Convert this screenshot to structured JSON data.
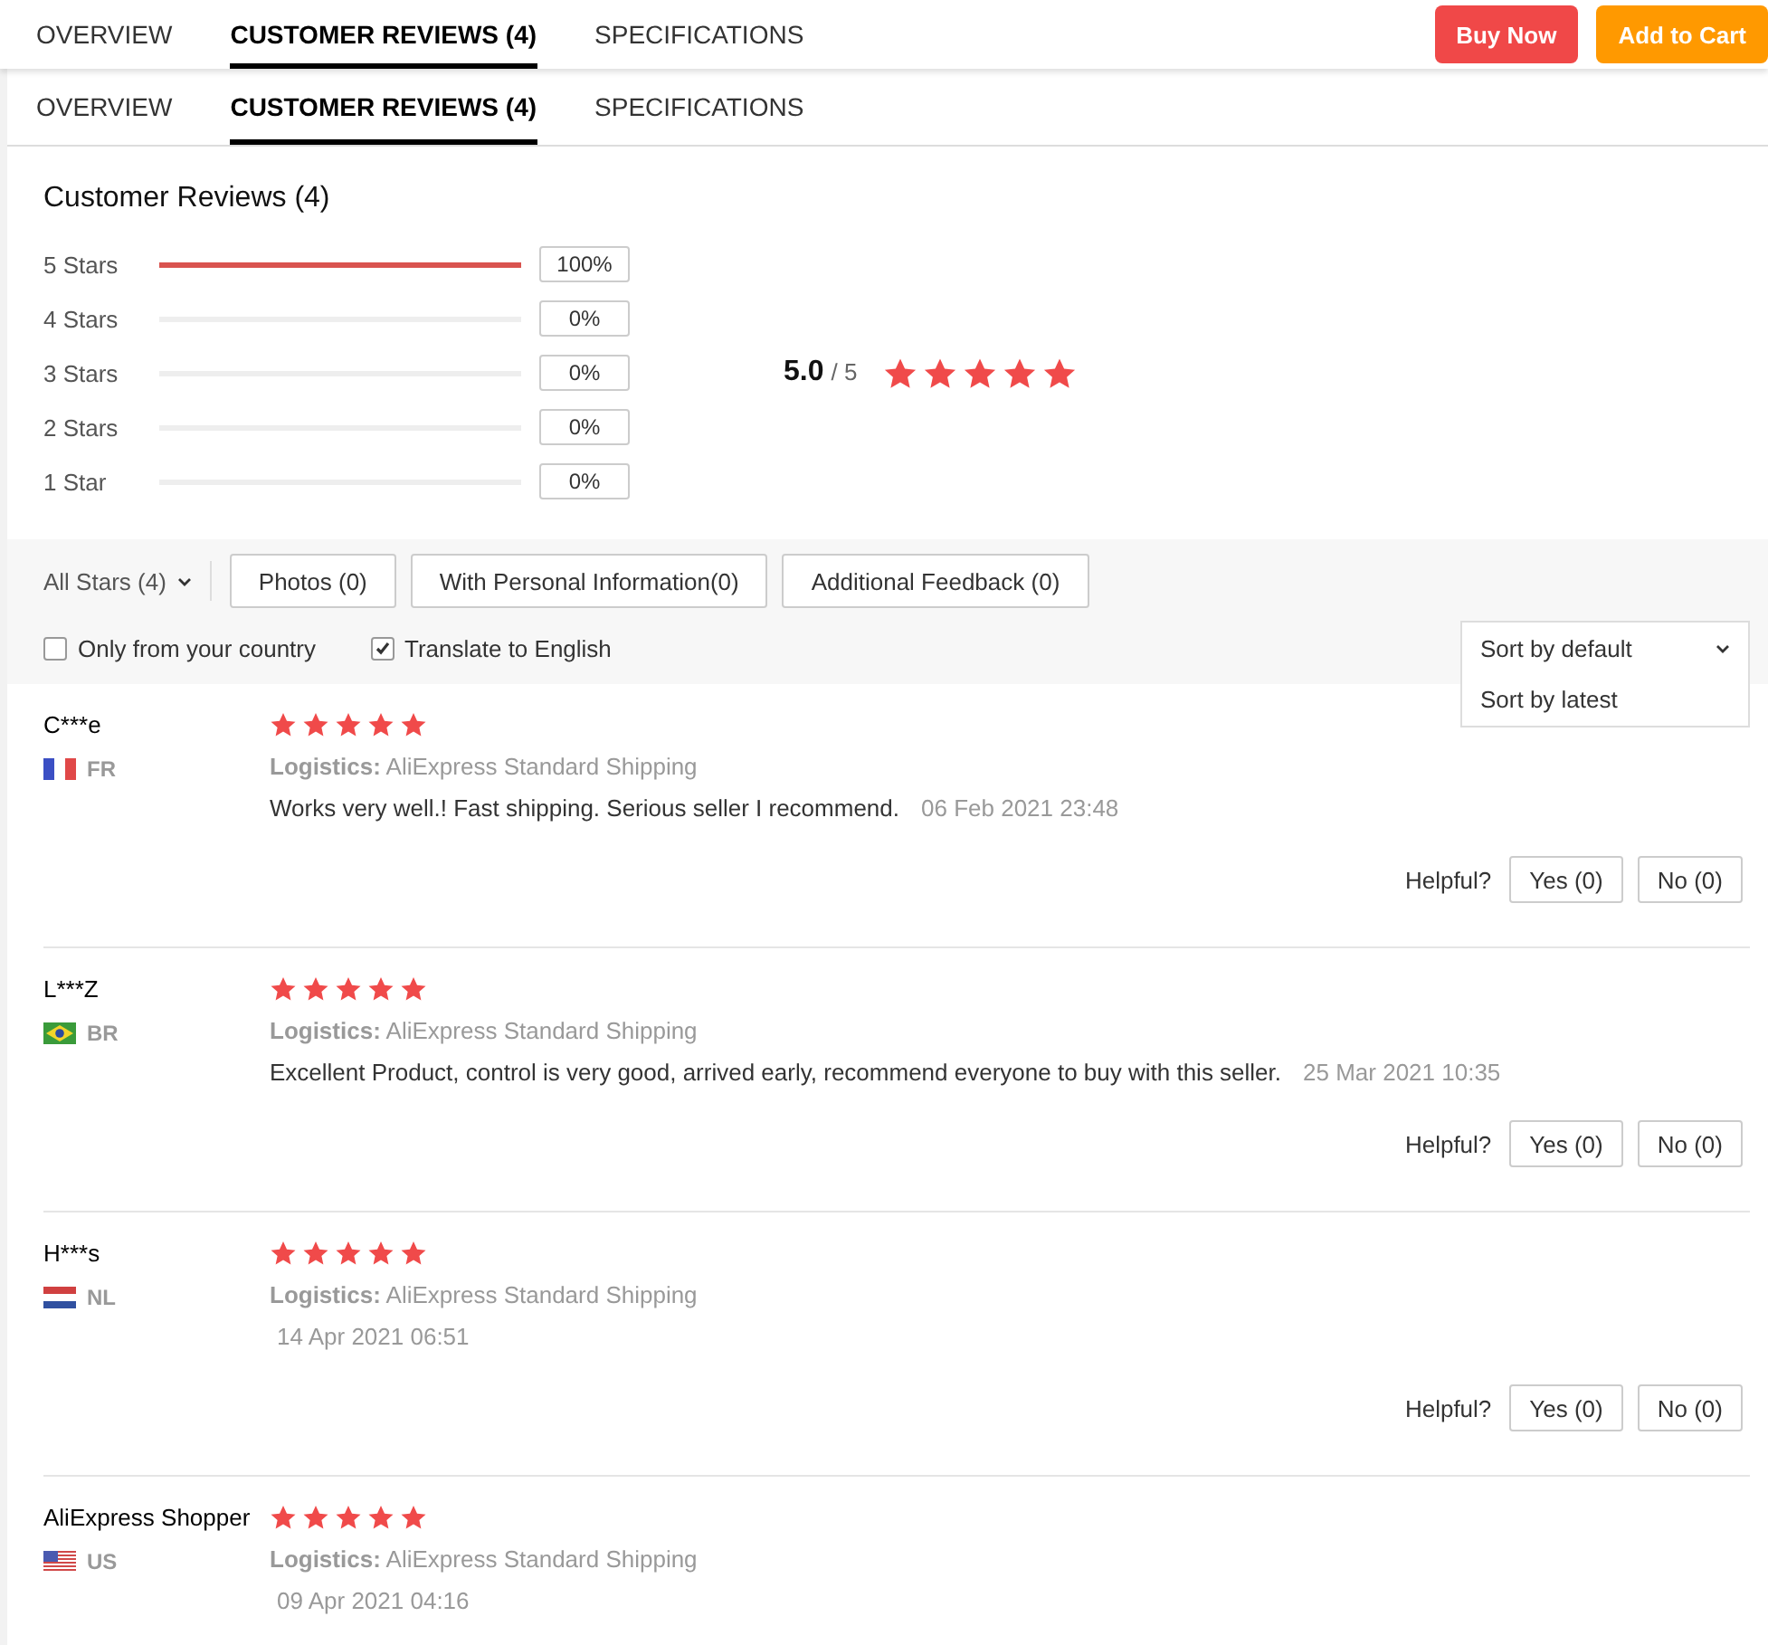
{
  "top_bar": {
    "tabs": [
      {
        "label": "OVERVIEW",
        "selected": false
      },
      {
        "label": "CUSTOMER REVIEWS (4)",
        "selected": true
      },
      {
        "label": "SPECIFICATIONS",
        "selected": false
      }
    ],
    "buttons": [
      {
        "label": "Buy Now",
        "kind": "buy"
      },
      {
        "label": "Add to Cart",
        "kind": "cart"
      }
    ]
  },
  "tabs": [
    {
      "label": "OVERVIEW",
      "selected": false
    },
    {
      "label": "CUSTOMER REVIEWS (4)",
      "selected": true
    },
    {
      "label": "SPECIFICATIONS",
      "selected": false
    }
  ],
  "summary": {
    "title": "Customer Reviews (4)",
    "histogram": [
      {
        "label": "5 Stars",
        "level": 1,
        "percent": "100%"
      },
      {
        "label": "4 Stars",
        "level": 0,
        "percent": "0%"
      },
      {
        "label": "3 Stars",
        "level": 0,
        "percent": "0%"
      },
      {
        "label": "2 Stars",
        "level": 0,
        "percent": "0%"
      },
      {
        "label": "1 Star",
        "level": 0,
        "percent": "0%"
      }
    ],
    "score": "5.0",
    "out_of": "/ 5",
    "stars": 5
  },
  "filters": {
    "star_filter": "All Stars (4)",
    "buttons": [
      "Photos (0)",
      "With Personal Information(0)",
      "Additional Feedback (0)"
    ],
    "checkboxes": [
      {
        "label": "Only from your country",
        "checked": false
      },
      {
        "label": "Translate to English",
        "checked": true
      }
    ],
    "sort": {
      "value": "Sort by default",
      "expanded": true,
      "options": [
        "Sort by latest"
      ]
    }
  },
  "reviews": [
    {
      "name": "C***e",
      "kind": "france",
      "country": "FR",
      "stars": 5,
      "logistics": "**Logistics:** AliExpress Standard Shipping",
      "text": "Works very well.! Fast shipping. Serious seller I recommend.",
      "date": "06 Feb 2021 23:48",
      "helpful_label": "Helpful?",
      "yes": "Yes (0)",
      "no": "No (0)"
    },
    {
      "name": "L***Z",
      "kind": "brazil",
      "country": "BR",
      "stars": 5,
      "logistics": "**Logistics:** AliExpress Standard Shipping",
      "text": "Excellent Product, control is very good, arrived early, recommend everyone to buy with this seller.",
      "date": "25 Mar 2021 10:35",
      "helpful_label": "Helpful?",
      "yes": "Yes (0)",
      "no": "No (0)"
    },
    {
      "name": "H***s",
      "kind": "netherlands",
      "country": "NL",
      "stars": 5,
      "logistics": "**Logistics:** AliExpress Standard Shipping",
      "date": "14 Apr 2021 06:51",
      "helpful_label": "Helpful?",
      "yes": "Yes (0)",
      "no": "No (0)"
    },
    {
      "name": "AliExpress Shopper",
      "kind": "usa",
      "country": "US",
      "stars": 5,
      "logistics": "**Logistics:** AliExpress Standard Shipping",
      "date": "09 Apr 2021 04:16"
    }
  ]
}
